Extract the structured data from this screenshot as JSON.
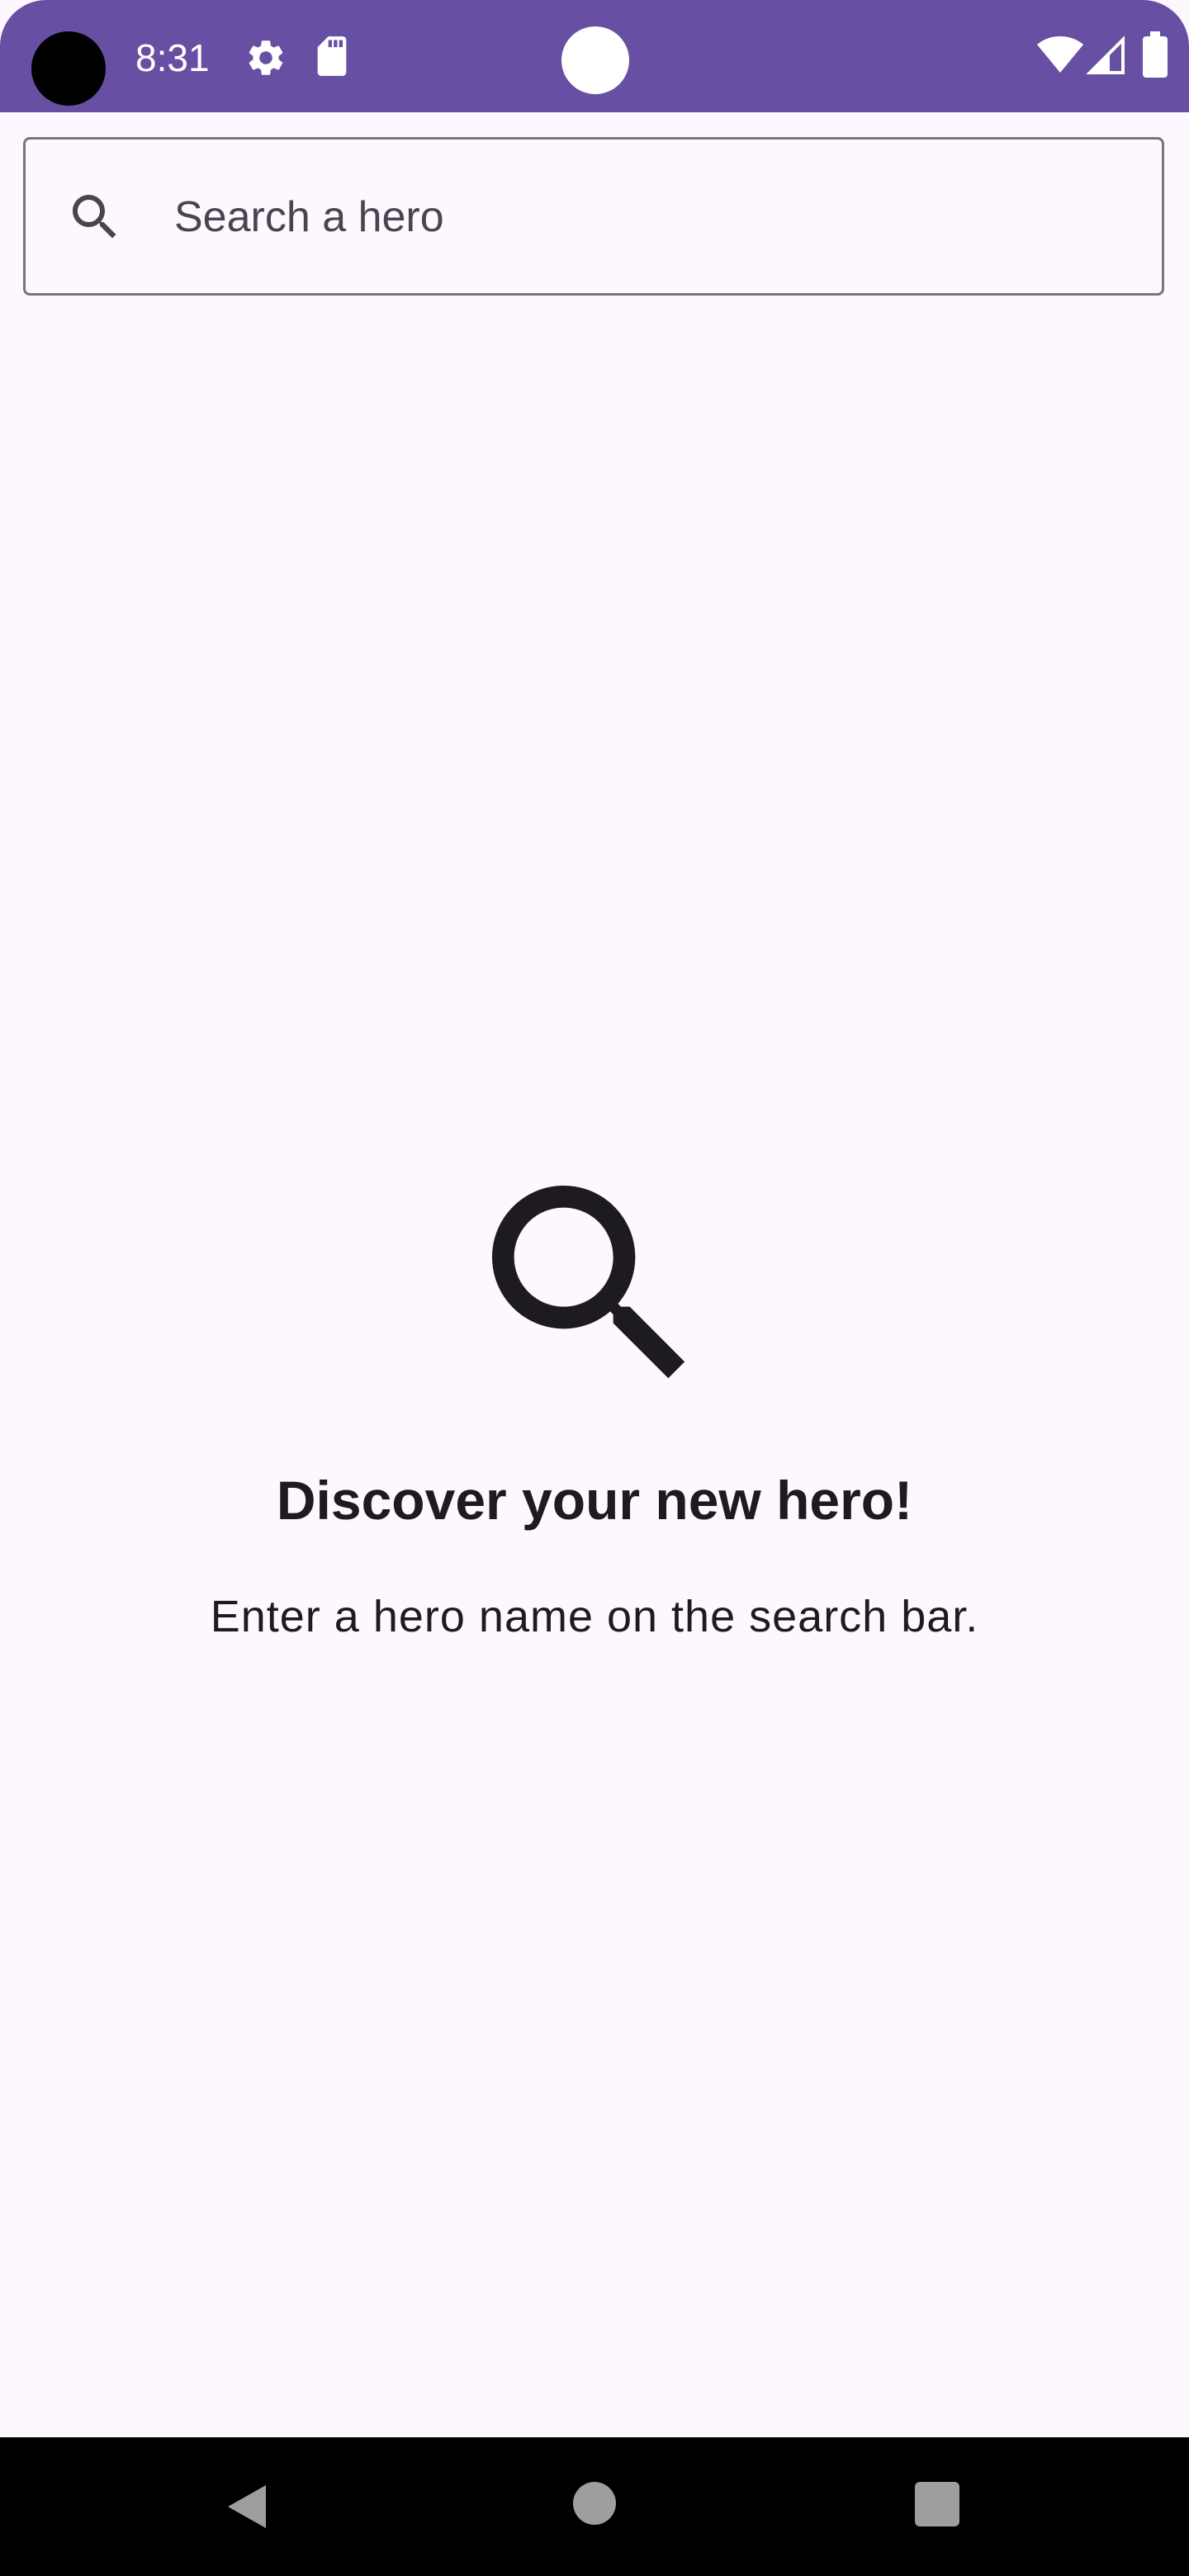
{
  "status_bar": {
    "time": "8:31",
    "icons": [
      "camera-cutout",
      "gear-icon",
      "sd-card-icon",
      "wifi-icon",
      "signal-icon",
      "battery-icon"
    ],
    "background_color": "#6750A4"
  },
  "search": {
    "placeholder": "Search a hero",
    "value": "",
    "icon": "search-icon"
  },
  "empty_state": {
    "icon": "search-icon",
    "title": "Discover your new hero!",
    "subtitle": "Enter a hero name on the search bar."
  },
  "nav_bar": {
    "buttons": [
      "back-icon",
      "home-icon",
      "recents-icon"
    ]
  },
  "colors": {
    "accent": "#6750A4",
    "background": "#FEF7FF",
    "text": "#1D1B20",
    "outline": "#79747E"
  }
}
